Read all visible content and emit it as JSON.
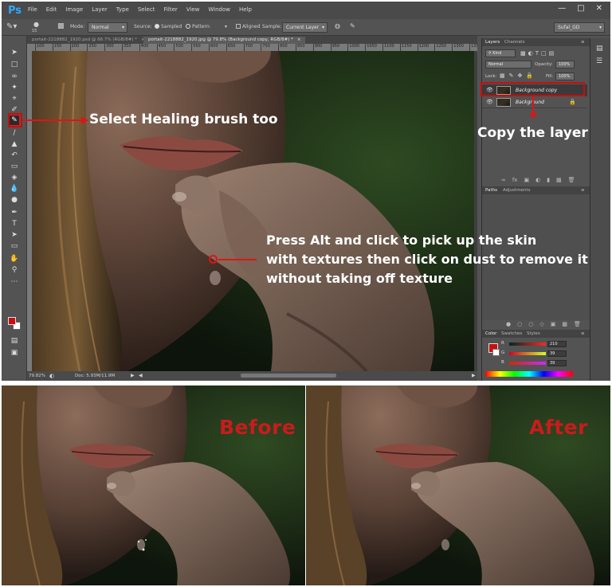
{
  "app": {
    "logo": "Ps"
  },
  "menu": [
    "File",
    "Edit",
    "Image",
    "Layer",
    "Type",
    "Select",
    "Filter",
    "View",
    "Window",
    "Help"
  ],
  "window_controls": [
    "—",
    "□",
    "✕"
  ],
  "options_bar": {
    "brush_size": "15",
    "mode_label": "Mode:",
    "mode_value": "Normal",
    "source_label": "Source:",
    "sampled": "Sampled",
    "pattern": "Pattern:",
    "aligned": "Aligned",
    "sample_label": "Sample:",
    "sample_value": "Current Layer",
    "workspace": "Sufal_GD"
  },
  "tabs": [
    {
      "label": "portait-2218882_1920.psd @ 66.7% (RGB/8#) *",
      "active": false
    },
    {
      "label": "portait-2218882_1920.jpg @ 79.8% (Background copy, RGB/8#) *",
      "active": true
    }
  ],
  "ruler_ticks": [
    "100",
    "150",
    "200",
    "250",
    "300",
    "350",
    "400",
    "450",
    "500",
    "550",
    "600",
    "650",
    "700",
    "750",
    "800",
    "850",
    "900",
    "950",
    "1000",
    "1050",
    "1100",
    "1150",
    "1200",
    "1250",
    "1300",
    "1350"
  ],
  "statusbar": {
    "zoom": "79.82%",
    "doc": "Doc: 5.93M/11.9M"
  },
  "layers_panel": {
    "tabs": [
      "Layers",
      "Channels"
    ],
    "kind": "Kind",
    "blend_mode": "Normal",
    "opacity_label": "Opacity:",
    "opacity": "100%",
    "lock_label": "Lock:",
    "fill_label": "Fill:",
    "fill": "100%",
    "layers": [
      {
        "name": "Background copy",
        "selected": true
      },
      {
        "name": "Background",
        "selected": false
      }
    ]
  },
  "paths_panel": {
    "tabs": [
      "Paths",
      "Adjustments"
    ]
  },
  "color_panel": {
    "tabs": [
      "Color",
      "Swatches",
      "Styles"
    ],
    "r_label": "R",
    "r": "210",
    "g_label": "G",
    "g": "39",
    "b_label": "B",
    "b": "39"
  },
  "annotations": {
    "healing": "Select Healing brush too",
    "copy": "Copy the layer",
    "alt_line1": "Press Alt and click to pick up the skin",
    "alt_line2": "with textures then click on dust to remove it",
    "alt_line3": "without taking off texture"
  },
  "comparison": {
    "before": "Before",
    "after": "After"
  },
  "colors": {
    "accent_red": "#e01414",
    "label_red": "#c81c1c",
    "ps_blue": "#31a8ff",
    "fg_swatch": "#c80f0f"
  }
}
